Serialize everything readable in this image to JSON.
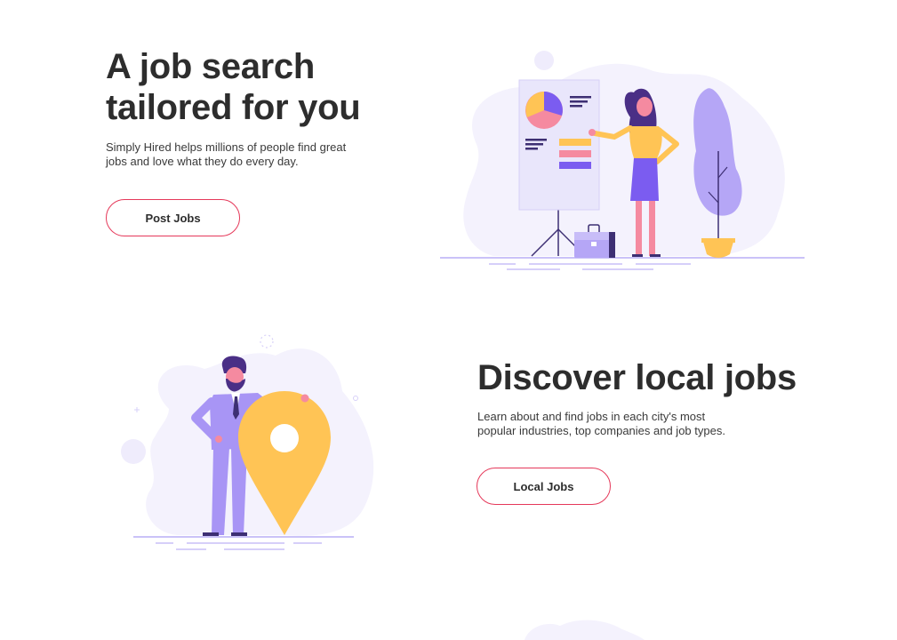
{
  "sections": [
    {
      "title": "A job search tailored for you",
      "description": "Simply Hired helps millions of people find great jobs and love what they do every day.",
      "button_label": "Post Jobs"
    },
    {
      "title": "Discover local jobs",
      "description": "Learn about and find jobs in each city's most popular industries, top companies and job types.",
      "button_label": "Local Jobs"
    }
  ],
  "colors": {
    "accent_border": "#e5395a",
    "heading": "#2d2d2d",
    "illustration_purple": "#7b5cf0",
    "illustration_lavender": "#a895f5",
    "illustration_yellow": "#ffc455",
    "illustration_pink": "#f58aa0",
    "blob": "#f4f2fd"
  },
  "illustrations": [
    "presentation-woman-illustration",
    "location-pin-man-illustration"
  ]
}
